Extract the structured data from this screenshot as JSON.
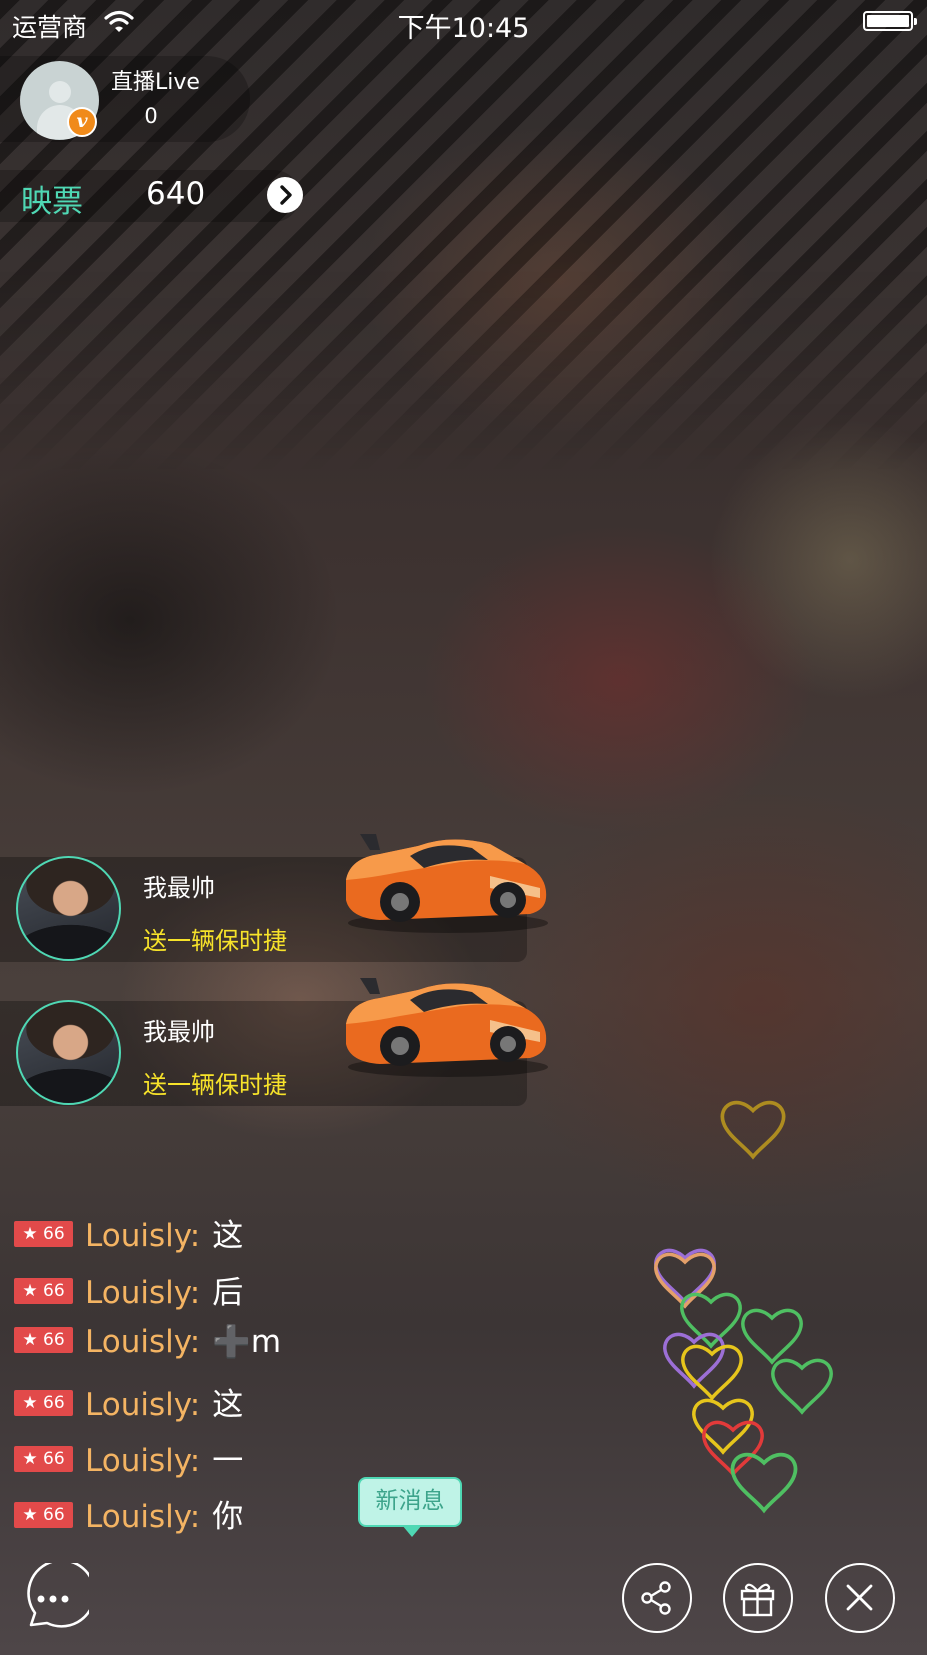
{
  "status_bar": {
    "carrier": "运营商",
    "time": "下午10:45",
    "wifi_icon": "wifi-icon",
    "battery_icon": "battery-icon",
    "battery_level": 1.0
  },
  "host": {
    "name": "直播Live",
    "count": "0",
    "badge_letter": "v",
    "avatar_icon": "default-avatar-icon"
  },
  "tickets": {
    "label": "映票",
    "value": "640",
    "arrow_icon": "chevron-right-icon"
  },
  "gifts": [
    {
      "sender": "我最帅",
      "description": "送一辆保时捷",
      "gift_icon": "sports-car-icon"
    },
    {
      "sender": "我最帅",
      "description": "送一辆保时捷",
      "gift_icon": "sports-car-icon"
    }
  ],
  "chat": [
    {
      "level": "★ 66",
      "user": "Louisly:",
      "message": "这"
    },
    {
      "level": "★ 66",
      "user": "Louisly:",
      "message": "后"
    },
    {
      "level": "★ 66",
      "user": "Louisly:",
      "message": "➕m"
    },
    {
      "level": "★ 66",
      "user": "Louisly:",
      "message": "这"
    },
    {
      "level": "★ 66",
      "user": "Louisly:",
      "message": "一"
    },
    {
      "level": "★ 66",
      "user": "Louisly:",
      "message": "你"
    }
  ],
  "new_message": "新消息",
  "controls": {
    "chat_icon": "chat-bubble-icon",
    "share_icon": "share-icon",
    "gift_icon": "gift-box-icon",
    "close_icon": "close-icon"
  },
  "colors": {
    "accent": "#4fd8b4",
    "gift_text": "#f7e32a",
    "chat_user": "#f4b463",
    "level_badge": "#e24a4a",
    "host_badge": "#f08a1a"
  },
  "hearts_icon": "floating-hearts-icon"
}
